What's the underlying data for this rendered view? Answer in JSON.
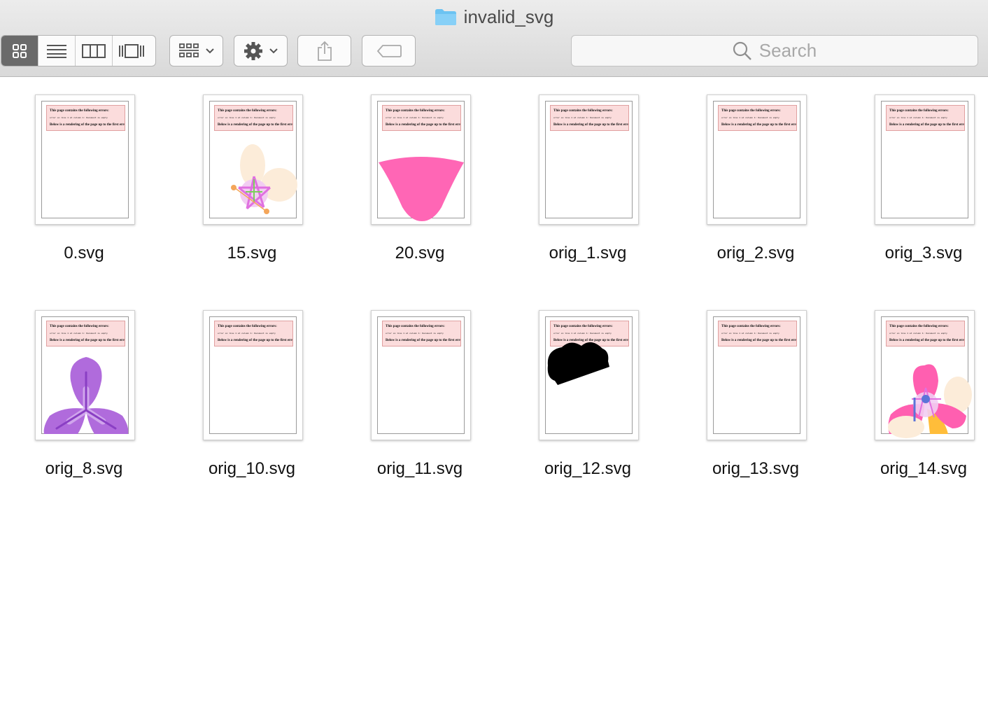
{
  "window": {
    "title": "invalid_svg",
    "folder_icon": "folder-icon",
    "accent": "#6cc3f2"
  },
  "toolbar": {
    "view_buttons": [
      {
        "name": "icon-view",
        "icon": "icon-grid-icon",
        "active": true
      },
      {
        "name": "list-view",
        "icon": "list-icon",
        "active": false
      },
      {
        "name": "column-view",
        "icon": "columns-icon",
        "active": false
      },
      {
        "name": "gallery-view",
        "icon": "coverflow-icon",
        "active": false
      }
    ],
    "group_icon": "group-grid-icon",
    "action_icon": "gear-icon",
    "share_icon": "share-icon",
    "tag_icon": "tag-icon",
    "search_placeholder": "Search",
    "search_icon": "search-icon"
  },
  "files": [
    {
      "name": "0.svg",
      "art": "none"
    },
    {
      "name": "15.svg",
      "art": "flower-peach"
    },
    {
      "name": "20.svg",
      "art": "pink-bowl"
    },
    {
      "name": "orig_1.svg",
      "art": "none"
    },
    {
      "name": "orig_2.svg",
      "art": "none"
    },
    {
      "name": "orig_3.svg",
      "art": "none"
    },
    {
      "name": "orig_8.svg",
      "art": "purple-flower"
    },
    {
      "name": "orig_10.svg",
      "art": "none"
    },
    {
      "name": "orig_11.svg",
      "art": "none"
    },
    {
      "name": "orig_12.svg",
      "art": "black-blob"
    },
    {
      "name": "orig_13.svg",
      "art": "none"
    },
    {
      "name": "orig_14.svg",
      "art": "pink-flower"
    }
  ],
  "error_box": {
    "heading": "This page contains the following errors:",
    "detail": "error on line 1 at column 1: Document is empty",
    "footer": "Below is a rendering of the page up to the first error."
  }
}
